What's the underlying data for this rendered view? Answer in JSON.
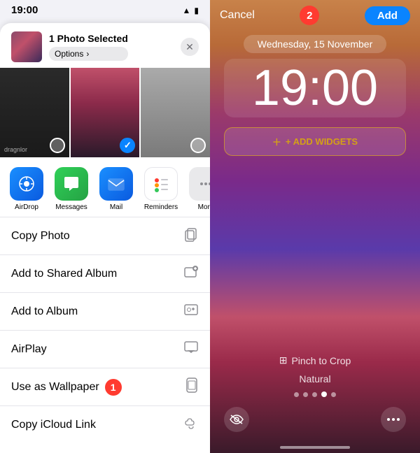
{
  "left": {
    "status_time": "19:00",
    "share_header": {
      "title": "1 Photo Selected",
      "options_label": "Options",
      "chevron": "›"
    },
    "apps": [
      {
        "id": "airdrop",
        "label": "AirDrop",
        "icon": "📡"
      },
      {
        "id": "messages",
        "label": "Messages",
        "icon": "💬"
      },
      {
        "id": "mail",
        "label": "Mail",
        "icon": "✉️"
      },
      {
        "id": "reminders",
        "label": "Reminders",
        "icon": "🔴"
      }
    ],
    "actions": [
      {
        "label": "Copy Photo",
        "icon": "⎘"
      },
      {
        "label": "Add to Shared Album",
        "icon": "🖼"
      },
      {
        "label": "Add to Album",
        "icon": "📁"
      },
      {
        "label": "AirPlay",
        "icon": "📺"
      },
      {
        "label": "Use as Wallpaper",
        "icon": "📱",
        "badge": "1"
      },
      {
        "label": "Copy iCloud Link",
        "icon": "☁"
      }
    ]
  },
  "right": {
    "cancel_label": "Cancel",
    "add_label": "Add",
    "badge_number": "2",
    "date_label": "Wednesday, 15 November",
    "time_label": "19:00",
    "add_widgets_label": "+ ADD WIDGETS",
    "pinch_crop_label": "Pinch to Crop",
    "natural_label": "Natural",
    "dots": [
      0,
      0,
      0,
      1,
      0
    ],
    "bottom_icons": [
      {
        "name": "eye-slash-icon",
        "symbol": "👁"
      },
      {
        "name": "ellipsis-icon",
        "symbol": "⋯"
      }
    ]
  }
}
